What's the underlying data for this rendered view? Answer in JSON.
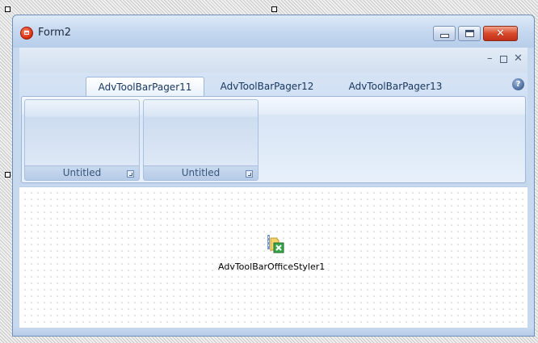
{
  "window": {
    "title": "Form2",
    "icon": "app-icon"
  },
  "caption_buttons": {
    "minimize_icon": "minimize-icon",
    "maximize_icon": "maximize-icon",
    "close_icon": "close-icon",
    "close_glyph": "✕"
  },
  "mdi_strip": {
    "minimize_glyph": "–",
    "close_glyph": "✕"
  },
  "ribbon": {
    "tabs": [
      {
        "label": "AdvToolBarPager11",
        "active": true
      },
      {
        "label": "AdvToolBarPager12",
        "active": false
      },
      {
        "label": "AdvToolBarPager13",
        "active": false
      }
    ],
    "help_glyph": "?",
    "groups": [
      {
        "label": "Untitled"
      },
      {
        "label": "Untitled"
      }
    ]
  },
  "design_surface": {
    "components": [
      {
        "label": "AdvToolBarOfficeStyler1",
        "icon": "toolbar-styler-icon"
      }
    ]
  },
  "colors": {
    "close_button": "#d8492a",
    "ribbon_background": "#c3d6ee",
    "tab_text": "#17365d"
  }
}
